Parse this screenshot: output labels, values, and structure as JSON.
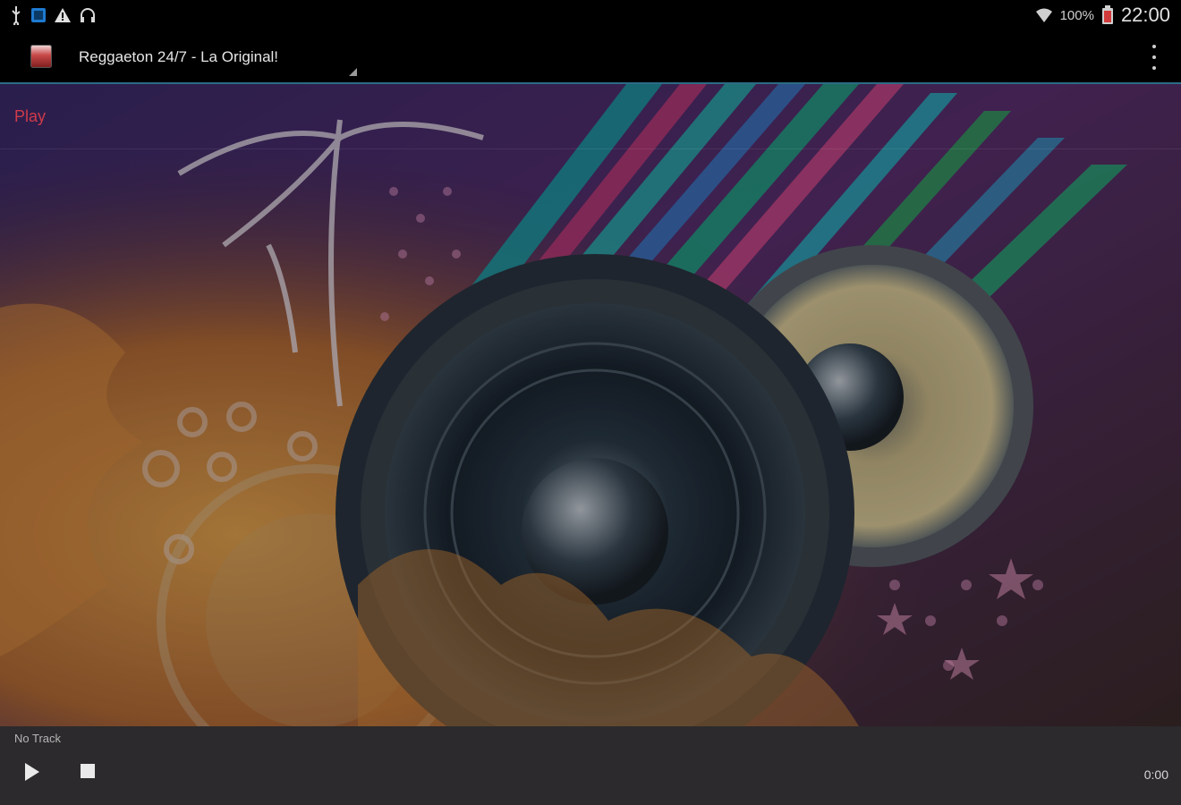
{
  "status_bar": {
    "left_icons": [
      "usb-icon",
      "checkbox-icon",
      "warning-icon",
      "headphones-icon"
    ],
    "battery": "100%",
    "time": "22:00"
  },
  "action_bar": {
    "title": "Reggaeton 24/7 - La Original!"
  },
  "main": {
    "play_label": "Play"
  },
  "player": {
    "track": "No Track",
    "elapsed": "0:00"
  },
  "colors": {
    "accent": "#cf3a4a",
    "action_bar_border": "#2b6b86"
  }
}
